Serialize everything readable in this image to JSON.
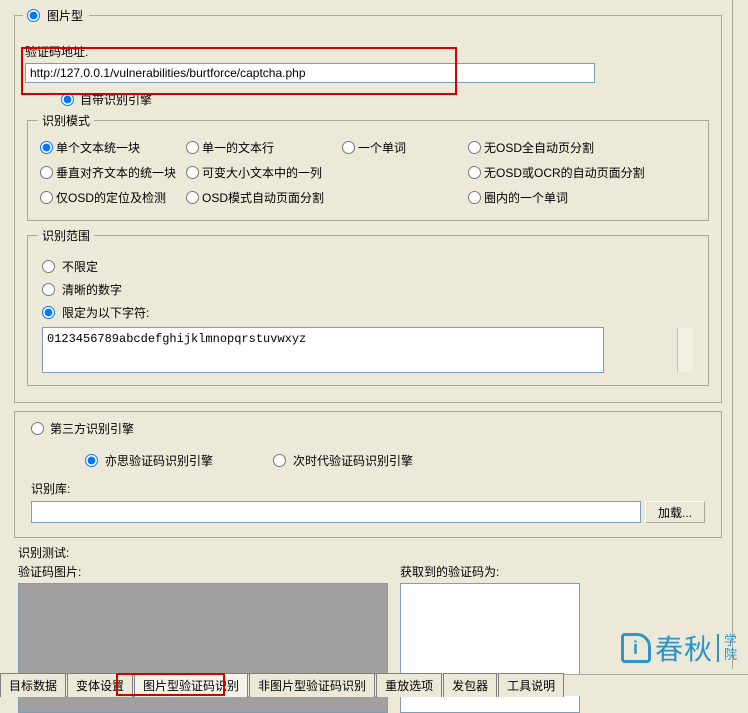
{
  "top": {
    "image_type": "图片型",
    "url_label": "验证码地址.",
    "url_value": "http://127.0.0.1/vulnerabilities/burtforce/captcha.php",
    "builtin_engine": "自带识别引擎"
  },
  "mode": {
    "legend": "识别模式",
    "r1c1": "单个文本统一块",
    "r1c2": "单一的文本行",
    "r1c3": "一个单词",
    "r1c4": "无OSD全自动页分割",
    "r2c1": "垂直对齐文本的统一块",
    "r2c2": "可变大小文本中的一列",
    "r2c4": "无OSD或OCR的自动页面分割",
    "r3c1": "仅OSD的定位及检测",
    "r3c2": "OSD模式自动页面分割",
    "r3c4": "圈内的一个单词"
  },
  "range": {
    "legend": "识别范围",
    "opt1": "不限定",
    "opt2": "清晰的数字",
    "opt3": "限定为以下字符:",
    "chars": "0123456789abcdefghijklmnopqrstuvwxyz"
  },
  "engine3": {
    "radio": "第三方识别引擎",
    "opt1": "亦思验证码识别引擎",
    "opt2": "次时代验证码识别引擎",
    "lib_label": "识别库:",
    "load_btn": "加载..."
  },
  "test": {
    "label": "识别测试:",
    "img_label": "验证码图片:",
    "code_label": "获取到的验证码为:"
  },
  "tabs": {
    "t1": "目标数据",
    "t2": "变体设置",
    "t3": "图片型验证码识别",
    "t4": "非图片型验证码识别",
    "t5": "重放选项",
    "t6": "发包器",
    "t7": "工具说明"
  },
  "watermark": {
    "text": "春秋",
    "suffix1": "学",
    "suffix2": "院"
  }
}
